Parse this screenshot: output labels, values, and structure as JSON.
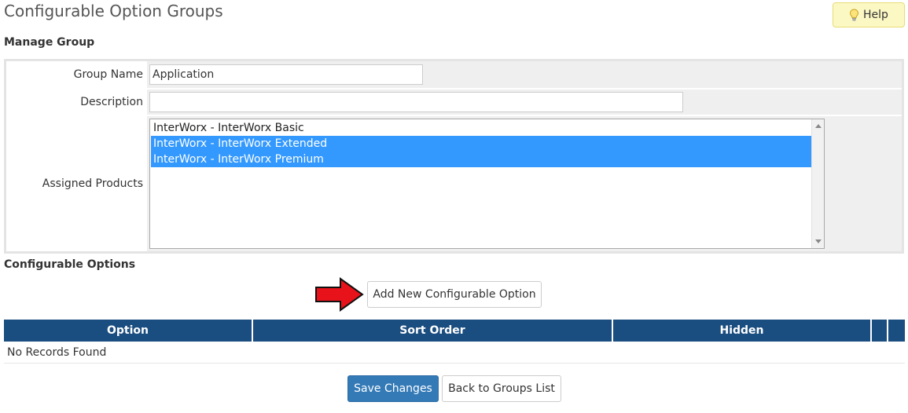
{
  "page": {
    "title": "Configurable Option Groups",
    "help_label": "Help"
  },
  "manage_group": {
    "heading": "Manage Group",
    "group_name": {
      "label": "Group Name",
      "value": "Application"
    },
    "description": {
      "label": "Description",
      "value": ""
    },
    "assigned_products": {
      "label": "Assigned Products",
      "options": [
        {
          "label": "InterWorx - InterWorx Basic",
          "selected": false
        },
        {
          "label": "InterWorx - InterWorx Extended",
          "selected": true
        },
        {
          "label": "InterWorx - InterWorx Premium",
          "selected": true
        }
      ]
    }
  },
  "configurable_options": {
    "heading": "Configurable Options",
    "add_button_label": "Add New Configurable Option",
    "table": {
      "columns": [
        "Option",
        "Sort Order",
        "Hidden",
        "",
        ""
      ],
      "empty_message": "No Records Found"
    }
  },
  "actions": {
    "save_label": "Save Changes",
    "back_label": "Back to Groups List"
  },
  "colors": {
    "table_header": "#1a4d80",
    "primary_button": "#337ab7",
    "selection": "#3399ff",
    "help_button": "#fcf8c4",
    "arrow": "#e8121a"
  },
  "icons": {
    "help": "lightbulb-icon",
    "pointer": "red-arrow-icon"
  }
}
